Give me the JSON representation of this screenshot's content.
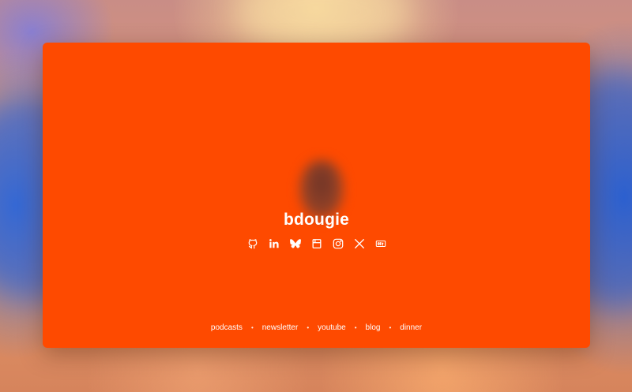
{
  "profile": {
    "name": "bdougie"
  },
  "socials": [
    {
      "icon": "github-icon"
    },
    {
      "icon": "linkedin-icon"
    },
    {
      "icon": "bluesky-icon"
    },
    {
      "icon": "bookmark-icon"
    },
    {
      "icon": "instagram-icon"
    },
    {
      "icon": "x-icon"
    },
    {
      "icon": "dev-icon"
    }
  ],
  "footer": {
    "links": [
      "podcasts",
      "newsletter",
      "youtube",
      "blog",
      "dinner"
    ],
    "separator": "•"
  },
  "colors": {
    "card": "#fe4a00",
    "text": "#ffffff"
  }
}
